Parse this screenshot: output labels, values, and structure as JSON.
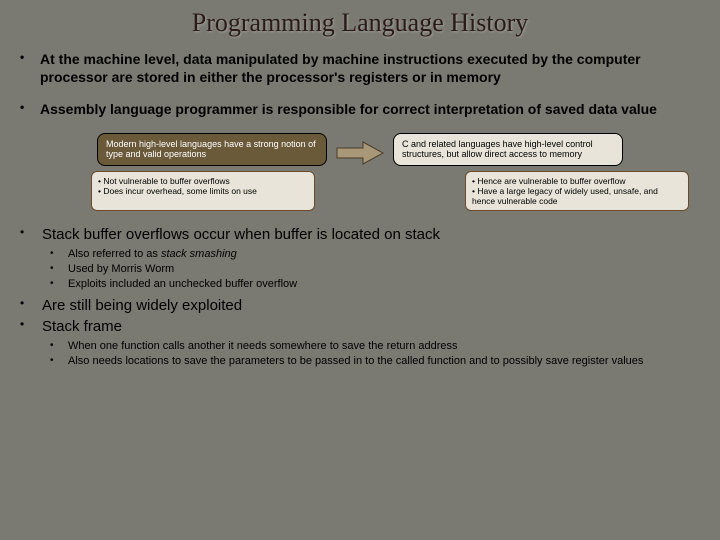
{
  "title": "Programming Language History",
  "bullets_top": [
    "At the machine level, data manipulated by machine instructions executed by the computer processor are stored in either the processor's registers or in memory",
    "Assembly language programmer is responsible for correct interpretation of saved data value"
  ],
  "diagram": {
    "left_main": "Modern high-level languages have a strong notion of type and valid operations",
    "left_sub": [
      "Not vulnerable to buffer overflows",
      "Does incur overhead, some limits on use"
    ],
    "right_main": "C and related languages have high-level control structures, but allow direct access to memory",
    "right_sub": [
      "Hence are vulnerable to buffer overflow",
      "Have a large legacy of widely used, unsafe, and hence vulnerable code"
    ]
  },
  "bullets_bottom": [
    {
      "text": "Stack buffer overflows occur when buffer is located on stack",
      "subs": [
        {
          "prefix": "Also referred to as ",
          "italic": "stack smashing",
          "suffix": ""
        },
        {
          "text": "Used by Morris Worm"
        },
        {
          "text": "Exploits included an unchecked buffer overflow"
        }
      ]
    },
    {
      "text": "Are still being widely exploited"
    },
    {
      "text": "Stack frame",
      "subs": [
        {
          "text": "When one function calls another it needs somewhere to save the return address"
        },
        {
          "text": "Also needs locations to save the parameters to be passed in to the called function and to possibly save register values"
        }
      ]
    }
  ]
}
